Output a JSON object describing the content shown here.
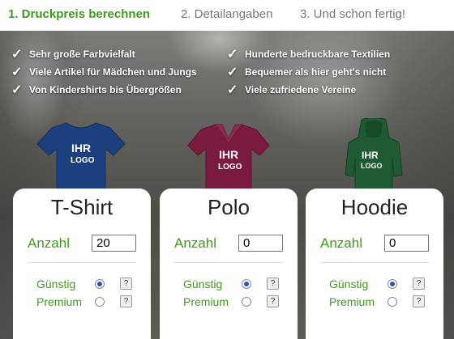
{
  "steps": [
    "1. Druckpreis berechnen",
    "2. Detailangaben",
    "3. Und schon fertig!"
  ],
  "features_left": [
    "Sehr große Farbvielfalt",
    "Viele Artikel für Mädchen und Jungs",
    "Von Kindershirts bis Übergrößen"
  ],
  "features_right": [
    "Hunderte bedruckbare Textilien",
    "Bequemer als hier geht's nicht",
    "Viele zufriedene Vereine"
  ],
  "check_glyph": "✓",
  "garment_print": [
    "IHR",
    "LOGO"
  ],
  "colors": {
    "accent": "#3f9a1c",
    "tshirt": "#1c3f7e",
    "polo": "#7a1a3f",
    "hoodie": "#1f5a32"
  },
  "products": [
    {
      "title": "T-Shirt",
      "qty_label": "Anzahl",
      "qty_value": "20",
      "option1": "Günstig",
      "option2": "Premium",
      "help": "?",
      "selected": "option1"
    },
    {
      "title": "Polo",
      "qty_label": "Anzahl",
      "qty_value": "0",
      "option1": "Günstig",
      "option2": "Premium",
      "help": "?",
      "selected": "option1"
    },
    {
      "title": "Hoodie",
      "qty_label": "Anzahl",
      "qty_value": "0",
      "option1": "Günstig",
      "option2": "Premium",
      "help": "?",
      "selected": "option1"
    }
  ]
}
